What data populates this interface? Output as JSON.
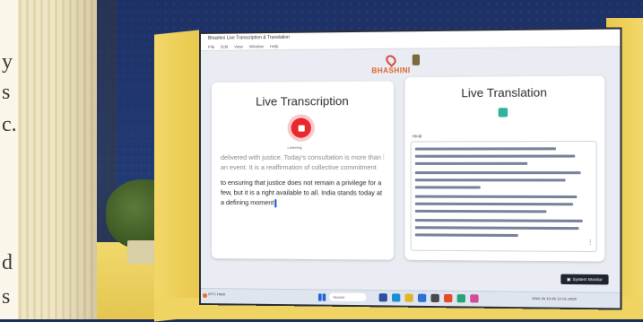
{
  "window": {
    "title": "Bhashini Live Transcription & Translation",
    "menu": [
      "File",
      "Edit",
      "View",
      "Window",
      "Help"
    ]
  },
  "brand": {
    "name": "BHASHINI",
    "color": "#e2622b"
  },
  "transcription": {
    "title": "Live Transcription",
    "status": "Listening",
    "text_faded": "delivered with justice. Today's consultation is more than an event. It is a reaffirmation of collective commitment",
    "text_live": "to ensuring that justice does not remain a privilege for a few, but it is a right available to all. India stands today at a defining moment",
    "record_color": "#e8272e"
  },
  "translation": {
    "title": "Live Translation",
    "language_label": "Hindi",
    "icon": "translate-icon"
  },
  "system_monitor": {
    "label": "System Monitor"
  },
  "taskbar": {
    "weather": "23°C Haze",
    "search_placeholder": "Search",
    "tray": "ENG IN  10:45  12-01-2025"
  },
  "environment": {
    "stray_letters": [
      "y",
      "s",
      "c.",
      "d",
      "s"
    ]
  }
}
